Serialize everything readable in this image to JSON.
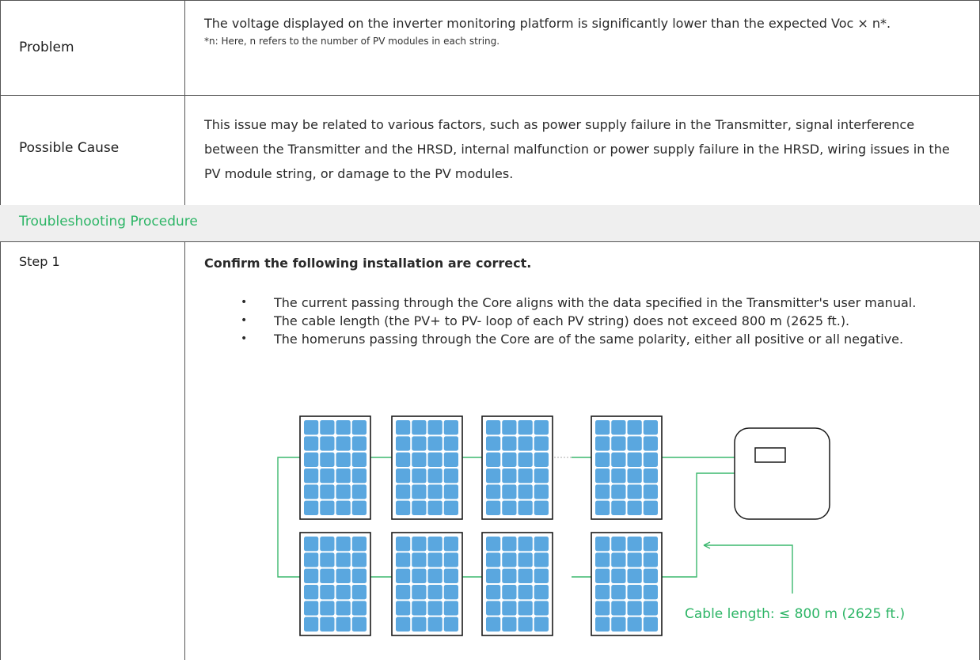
{
  "table": {
    "problem": {
      "label": "Problem",
      "text": "The voltage displayed on the inverter monitoring platform is significantly lower than the expected Voc × n*.",
      "note": "*n: Here, n refers to the number of PV modules in each string."
    },
    "cause": {
      "label": "Possible Cause",
      "text": "This issue may be related to various factors, such as power supply failure in the Transmitter, signal interference between the Transmitter and the HRSD, internal malfunction or power supply failure in the HRSD, wiring issues in the PV module string, or damage to the PV modules."
    },
    "procedure_title": "Troubleshooting Procedure",
    "step1": {
      "label": "Step 1",
      "heading": "Confirm the following installation are correct.",
      "bullets": [
        "The current passing through the Core aligns with the data specified in the Transmitter's user manual.",
        "The cable length (the PV+ to PV- loop of each PV string) does not exceed 800 m (2625 ft.).",
        "The homeruns passing through the Core are of the same polarity, either all positive or all negative."
      ],
      "bullet_glyph": "•"
    }
  },
  "diagram": {
    "caption": "Cable length: ≤ 800 m (2625 ft.)",
    "colors": {
      "cell": "#5aa7df",
      "frame": "#1a1a1a",
      "wire": "#3cb86e",
      "caption": "#2db566"
    },
    "icons": [
      "solar-panel-icon",
      "inverter-icon",
      "arrow-icon"
    ]
  }
}
